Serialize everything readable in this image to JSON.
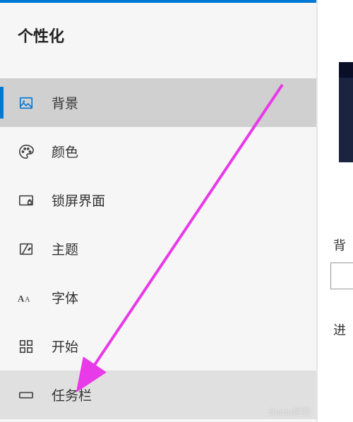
{
  "section_title": "个性化",
  "nav": {
    "items": [
      {
        "label": "背景",
        "icon": "image-icon"
      },
      {
        "label": "颜色",
        "icon": "palette-icon"
      },
      {
        "label": "锁屏界面",
        "icon": "lock-screen-icon"
      },
      {
        "label": "主题",
        "icon": "theme-icon"
      },
      {
        "label": "字体",
        "icon": "font-icon"
      },
      {
        "label": "开始",
        "icon": "start-icon"
      },
      {
        "label": "任务栏",
        "icon": "taskbar-icon"
      }
    ]
  },
  "right": {
    "label1": "背",
    "label2": "进"
  },
  "watermark": "Baidu经验"
}
